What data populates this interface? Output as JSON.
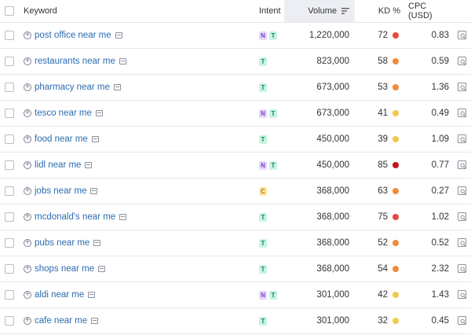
{
  "header": {
    "keyword": "Keyword",
    "intent": "Intent",
    "volume": "Volume",
    "kd": "KD %",
    "cpc": "CPC (USD)"
  },
  "colors": {
    "kd_red": "#e5483f",
    "kd_dark_red": "#c5111e",
    "kd_orange": "#f08b3a",
    "kd_yellow": "#f2c94c"
  },
  "rows": [
    {
      "keyword": "post office near me",
      "intent": [
        "N",
        "T"
      ],
      "volume": "1,220,000",
      "kd": "72",
      "kd_color": "#e5483f",
      "cpc": "0.83"
    },
    {
      "keyword": "restaurants near me",
      "intent": [
        "T"
      ],
      "volume": "823,000",
      "kd": "58",
      "kd_color": "#f08b3a",
      "cpc": "0.59"
    },
    {
      "keyword": "pharmacy near me",
      "intent": [
        "T"
      ],
      "volume": "673,000",
      "kd": "53",
      "kd_color": "#f08b3a",
      "cpc": "1.36"
    },
    {
      "keyword": "tesco near me",
      "intent": [
        "N",
        "T"
      ],
      "volume": "673,000",
      "kd": "41",
      "kd_color": "#f2c94c",
      "cpc": "0.49"
    },
    {
      "keyword": "food near me",
      "intent": [
        "T"
      ],
      "volume": "450,000",
      "kd": "39",
      "kd_color": "#f2c94c",
      "cpc": "1.09"
    },
    {
      "keyword": "lidl near me",
      "intent": [
        "N",
        "T"
      ],
      "volume": "450,000",
      "kd": "85",
      "kd_color": "#c5111e",
      "cpc": "0.77"
    },
    {
      "keyword": "jobs near me",
      "intent": [
        "C"
      ],
      "volume": "368,000",
      "kd": "63",
      "kd_color": "#f08b3a",
      "cpc": "0.27"
    },
    {
      "keyword": "mcdonald's near me",
      "intent": [
        "T"
      ],
      "volume": "368,000",
      "kd": "75",
      "kd_color": "#e5483f",
      "cpc": "1.02"
    },
    {
      "keyword": "pubs near me",
      "intent": [
        "T"
      ],
      "volume": "368,000",
      "kd": "52",
      "kd_color": "#f08b3a",
      "cpc": "0.52"
    },
    {
      "keyword": "shops near me",
      "intent": [
        "T"
      ],
      "volume": "368,000",
      "kd": "54",
      "kd_color": "#f08b3a",
      "cpc": "2.32"
    },
    {
      "keyword": "aldi near me",
      "intent": [
        "N",
        "T"
      ],
      "volume": "301,000",
      "kd": "42",
      "kd_color": "#f2c94c",
      "cpc": "1.43"
    },
    {
      "keyword": "cafe near me",
      "intent": [
        "T"
      ],
      "volume": "301,000",
      "kd": "32",
      "kd_color": "#f2c94c",
      "cpc": "0.45"
    }
  ]
}
